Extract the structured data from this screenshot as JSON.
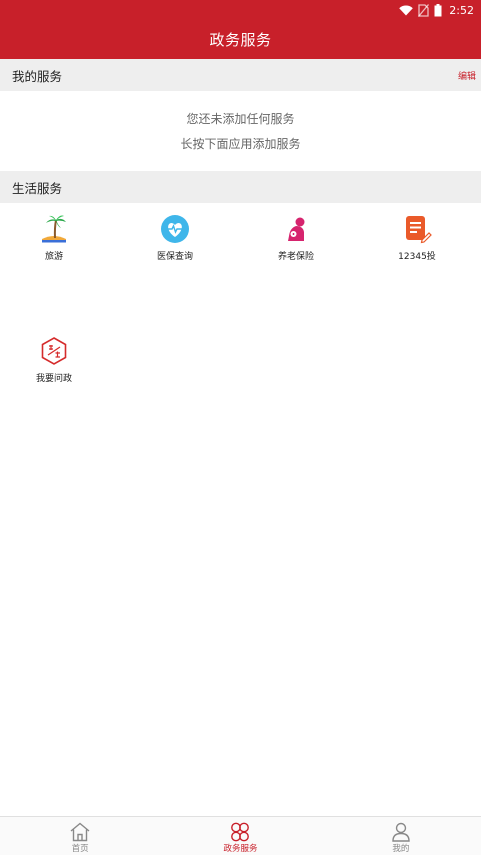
{
  "status_bar": {
    "time": "2:52",
    "icons": [
      "wifi-icon",
      "no-sim-icon",
      "battery-icon"
    ]
  },
  "header": {
    "title": "政务服务"
  },
  "my_services": {
    "title": "我的服务",
    "edit_label": "编辑",
    "empty_line1": "您还未添加任何服务",
    "empty_line2": "长按下面应用添加服务"
  },
  "life_services": {
    "title": "生活服务",
    "items": [
      {
        "label": "旅游",
        "icon": "beach-palm-icon",
        "color": "#2aa84a"
      },
      {
        "label": "医保查询",
        "icon": "medical-heart-icon",
        "color": "#3fb6ea"
      },
      {
        "label": "养老保险",
        "icon": "elder-person-icon",
        "color": "#d6246e"
      },
      {
        "label": "12345投",
        "icon": "document-edit-icon",
        "color": "#ea5a2a"
      },
      {
        "label": "我要问政",
        "icon": "consult-hexagon-icon",
        "color": "#d52b2b"
      }
    ]
  },
  "bottom_nav": {
    "items": [
      {
        "label": "首页",
        "icon": "home-icon",
        "active": false
      },
      {
        "label": "政务服务",
        "icon": "clover-icon",
        "active": true
      },
      {
        "label": "我的",
        "icon": "user-icon",
        "active": false
      }
    ]
  },
  "colors": {
    "brand_red": "#c8202a",
    "section_bg": "#eeeeee"
  }
}
